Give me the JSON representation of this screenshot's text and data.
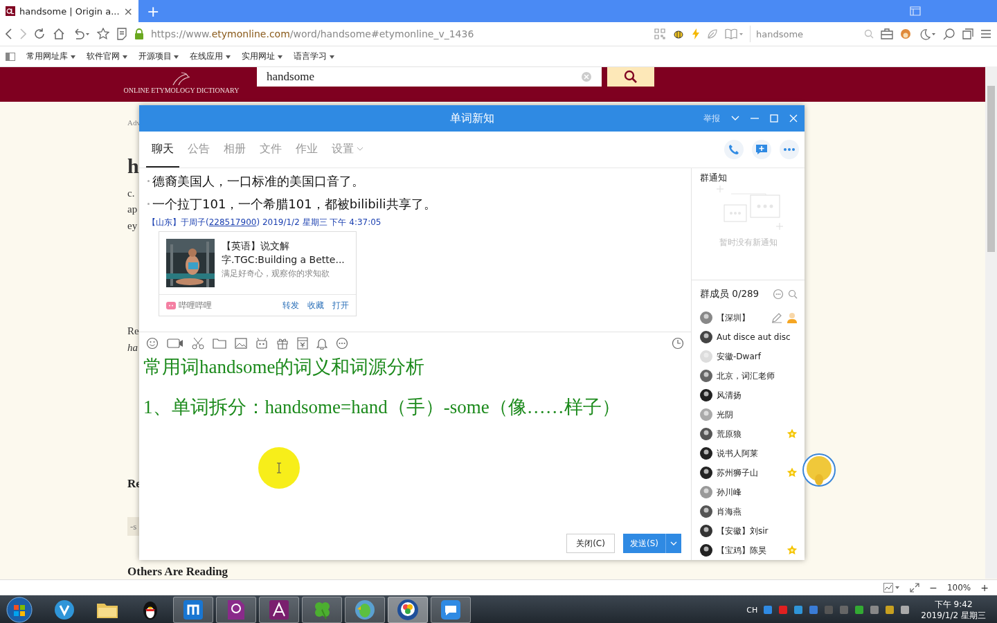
{
  "browser": {
    "tab": {
      "title": "handsome | Origin a...",
      "close": "×"
    },
    "new_tab": "+",
    "address": {
      "prefix": "https://www.",
      "domain": "etymonline.com",
      "path": "/word/handsome#etymonline_v_1436"
    },
    "search": {
      "value": "handsome"
    },
    "bookmarks": [
      "常用网址库",
      "软件官网",
      "开源项目",
      "在线应用",
      "实用网址",
      "语言学习"
    ]
  },
  "page": {
    "logo": "ONLINE ETYMOLOGY DICTIONARY",
    "search": {
      "value": "handsome"
    },
    "fragments": [
      {
        "kind": "note",
        "text": "Adv"
      },
      {
        "kind": "title",
        "text": "h"
      },
      {
        "kind": "text",
        "text": "c."
      },
      {
        "kind": "text",
        "text": "ap"
      },
      {
        "kind": "text",
        "text": "ey"
      },
      {
        "kind": "text",
        "text": "Re"
      },
      {
        "kind": "italic",
        "text": "ha"
      },
      {
        "kind": "heading",
        "text": "Re"
      },
      {
        "kind": "tag",
        "text": "-s"
      },
      {
        "kind": "heading",
        "text": "Others Are Reading"
      }
    ]
  },
  "chat": {
    "title": "单词新知",
    "report": "举报",
    "tabs": [
      {
        "label": "聊天",
        "selected": true,
        "dropdown": false
      },
      {
        "label": "公告",
        "selected": false,
        "dropdown": false
      },
      {
        "label": "相册",
        "selected": false,
        "dropdown": false
      },
      {
        "label": "文件",
        "selected": false,
        "dropdown": false
      },
      {
        "label": "作业",
        "selected": false,
        "dropdown": false
      },
      {
        "label": "设置",
        "selected": false,
        "dropdown": true
      }
    ],
    "messages": {
      "lines": [
        "德裔美国人，一口标准的美国口音了。",
        "一个拉丁101，一个希腊101，都被bilibili共享了。"
      ],
      "sender": {
        "prefix": "【山东】于周子(",
        "id": "228517900",
        "suffix": ") 2019/1/2 星期三 下午 4:37:05"
      },
      "card": {
        "title": "【英语】说文解字.TGC:Building a Bette...",
        "description": "满足好奇心，观察你的求知欲",
        "source": "哔哩哔哩",
        "actions": [
          "转发",
          "收藏",
          "打开"
        ]
      }
    },
    "draft": [
      "常用词handsome的词义和词源分析",
      "1、单词拆分：handsome=hand（手）-some（像……样子）"
    ],
    "buttons": {
      "close": "关闭(C)",
      "send": "发送(S)"
    },
    "notice": {
      "title": "群通知",
      "empty": "暂时没有新通知"
    },
    "members": {
      "title": "群成员 0/289",
      "items": [
        {
          "name": "【深圳】",
          "kind": "admin"
        },
        {
          "name": "Aut disce aut disc",
          "kind": "plain"
        },
        {
          "name": "安徽-Dwarf",
          "kind": "plain"
        },
        {
          "name": "北京，词汇老师",
          "kind": "plain"
        },
        {
          "name": "风清扬",
          "kind": "plain"
        },
        {
          "name": "光阴",
          "kind": "plain"
        },
        {
          "name": "荒原狼",
          "kind": "star"
        },
        {
          "name": "说书人阿莱",
          "kind": "plain"
        },
        {
          "name": "苏州狮子山",
          "kind": "star"
        },
        {
          "name": "孙川峰",
          "kind": "plain"
        },
        {
          "name": "肖海燕",
          "kind": "plain"
        },
        {
          "name": "【安徽】刘sir",
          "kind": "plain"
        },
        {
          "name": "【宝鸡】陈昊",
          "kind": "star"
        }
      ]
    }
  },
  "status_bar": {
    "minus": "−",
    "zoom": "100%",
    "plus": "+"
  },
  "taskbar": {
    "apps": [
      {
        "kind": "browser-v",
        "active": false,
        "selected": false
      },
      {
        "kind": "folder",
        "active": false,
        "selected": false
      },
      {
        "kind": "penguin",
        "active": false,
        "selected": false
      },
      {
        "kind": "square-m",
        "active": true,
        "selected": false
      },
      {
        "kind": "pdf",
        "active": true,
        "selected": false
      },
      {
        "kind": "arch",
        "active": true,
        "selected": false
      },
      {
        "kind": "clover",
        "active": true,
        "selected": false
      },
      {
        "kind": "parrot",
        "active": true,
        "selected": false
      },
      {
        "kind": "brain",
        "active": true,
        "selected": true
      },
      {
        "kind": "chat",
        "active": true,
        "selected": false
      }
    ],
    "input": "CH",
    "time": "下午 9:42",
    "date": "2019/1/2 星期三"
  }
}
